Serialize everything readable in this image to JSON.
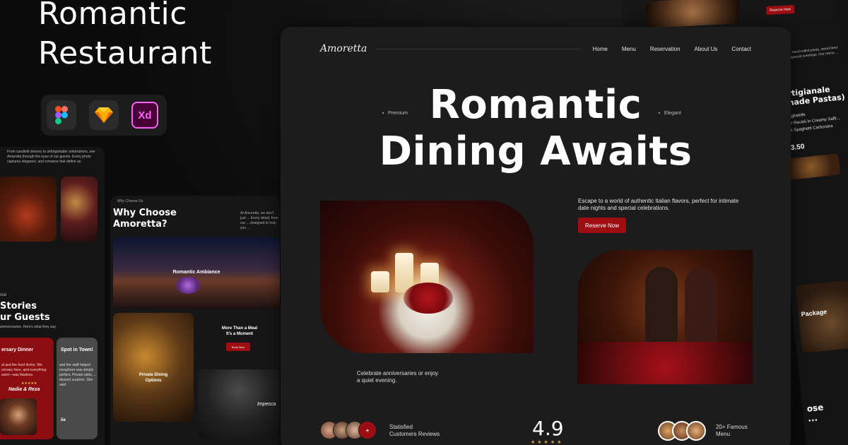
{
  "promo": {
    "title_line1": "Romantic",
    "title_line2": "Restaurant",
    "tools": [
      {
        "icon": "figma-icon",
        "label": ""
      },
      {
        "icon": "sketch-icon",
        "label": ""
      },
      {
        "icon": "xd-icon",
        "label": "Xd"
      }
    ]
  },
  "left_card": {
    "intro": "From candlelit dinners to unforgettable celebrations, see Amoretta through the eyes of our guests. Every photo captures elegance, and romance that define us.",
    "eyebrow": "imonial",
    "title_line1": "Stories",
    "title_line2": "ur Guests",
    "subtitle": "anniversaries. Here's what they say.",
    "review1": {
      "title": "ersary Dinner",
      "body": "al and the food divine. We versary here, and everything ssert—was flawless.",
      "stars": "★★★★★",
      "name": "Nadia & Reza"
    },
    "review2": {
      "title": "Spot in Town!",
      "body": "and the staff helped mosphere was simply perfect. Private table, ... dessert surprise. She said",
      "name": "lia"
    }
  },
  "mid_card": {
    "eyebrow": "Why Choose Us",
    "title_line1": "Why Choose",
    "title_line2": "Amoretta?",
    "description": "At Amoretta, we don't just ... Every detail, from our ... designed to help you ...",
    "ambiance_label": "Romantic Ambiance",
    "private_label_line1": "Private Dining",
    "private_label_line2": "Options",
    "meal_line1": "More Than a Meal",
    "meal_line2": "It's a Moment",
    "book_label": "Book Now",
    "chef_label": "Impecca"
  },
  "right_peek": {
    "reserve_label": "Reserve Now",
    "text": "made with ... hand-rolled pasta, wood-fired pizza, ... for special evenings. Our menu ... of love.",
    "title_line1": "a Artigianale",
    "title_line2": "ndmade Pastas)",
    "items": [
      "uffle Tagliatelle",
      "Lobster Ravioli in Creamy Saffr...",
      "Classic Spaghetti Carbonara"
    ],
    "price": "$ 13.50",
    "package_label": "Package",
    "bottom_title_line1": "ose",
    "bottom_title_line2": "..."
  },
  "main": {
    "logo": "Amoretta",
    "nav": [
      "Home",
      "Menu",
      "Reservation",
      "About Us",
      "Contact"
    ],
    "hero_left": "Premium",
    "hero_right": "Elegant",
    "hero_title_line1": "Romantic",
    "hero_title_line2": "Dining Awaits",
    "hero_desc": "Escape to a world of authentic Italian flavors, perfect for intimate date nights and special celebrations.",
    "reserve_label": "Reserve Now",
    "below_text": "Celebrate anniversaries or enjoy a quiet evening.",
    "stats": {
      "avatar_plus": "+",
      "customers_line1": "Statisfied",
      "customers_line2": "Customers Reviews",
      "rating": "4.9",
      "rating_stars": "★★★★★",
      "menu_line1": "20+ Famous",
      "menu_line2": "Menu"
    }
  },
  "colors": {
    "accent": "#9e0d12",
    "background": "#0b0b0b",
    "panel": "#1c1c1c",
    "star": "#d3a64a"
  }
}
